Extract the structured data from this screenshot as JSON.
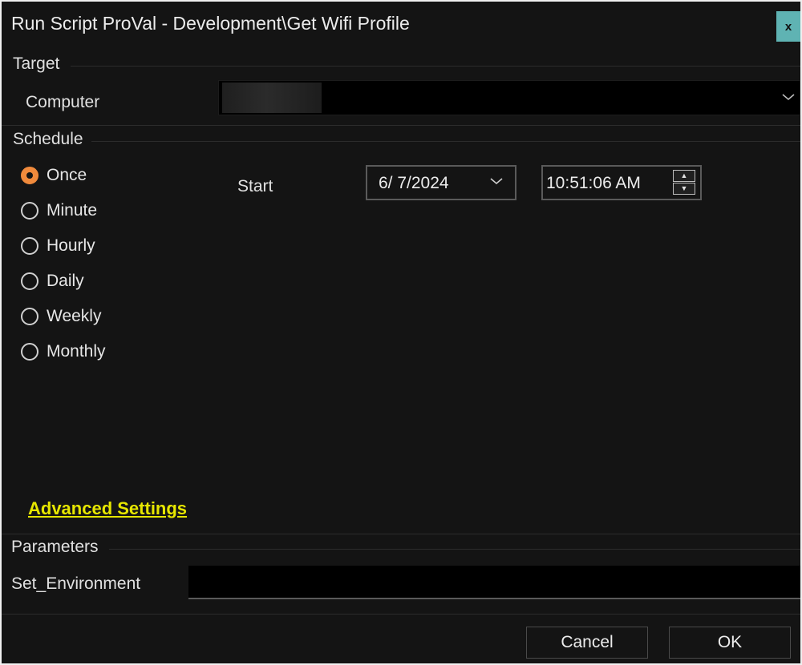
{
  "window": {
    "title": "Run Script ProVal - Development\\Get Wifi Profile",
    "close_label": "x"
  },
  "target": {
    "section_label": "Target",
    "computer_label": "Computer",
    "computer_value": ""
  },
  "schedule": {
    "section_label": "Schedule",
    "options": [
      {
        "label": "Once",
        "checked": true
      },
      {
        "label": "Minute",
        "checked": false
      },
      {
        "label": "Hourly",
        "checked": false
      },
      {
        "label": "Daily",
        "checked": false
      },
      {
        "label": "Weekly",
        "checked": false
      },
      {
        "label": "Monthly",
        "checked": false
      }
    ],
    "start_label": "Start",
    "start_date": "6/  7/2024",
    "start_time": "10:51:06 AM",
    "advanced_link": "Advanced Settings"
  },
  "parameters": {
    "section_label": "Parameters",
    "set_environment_label": "Set_Environment",
    "set_environment_value": ""
  },
  "footer": {
    "cancel_label": "Cancel",
    "ok_label": "OK"
  },
  "colors": {
    "background": "#141414",
    "accent_radio": "#f08a3c",
    "close_button": "#5fb3b3",
    "link": "#e6e600"
  },
  "icons": {
    "close": "close-icon",
    "dropdown": "chevron-down-icon",
    "spin_up": "spin-up-icon",
    "spin_down": "spin-down-icon"
  }
}
